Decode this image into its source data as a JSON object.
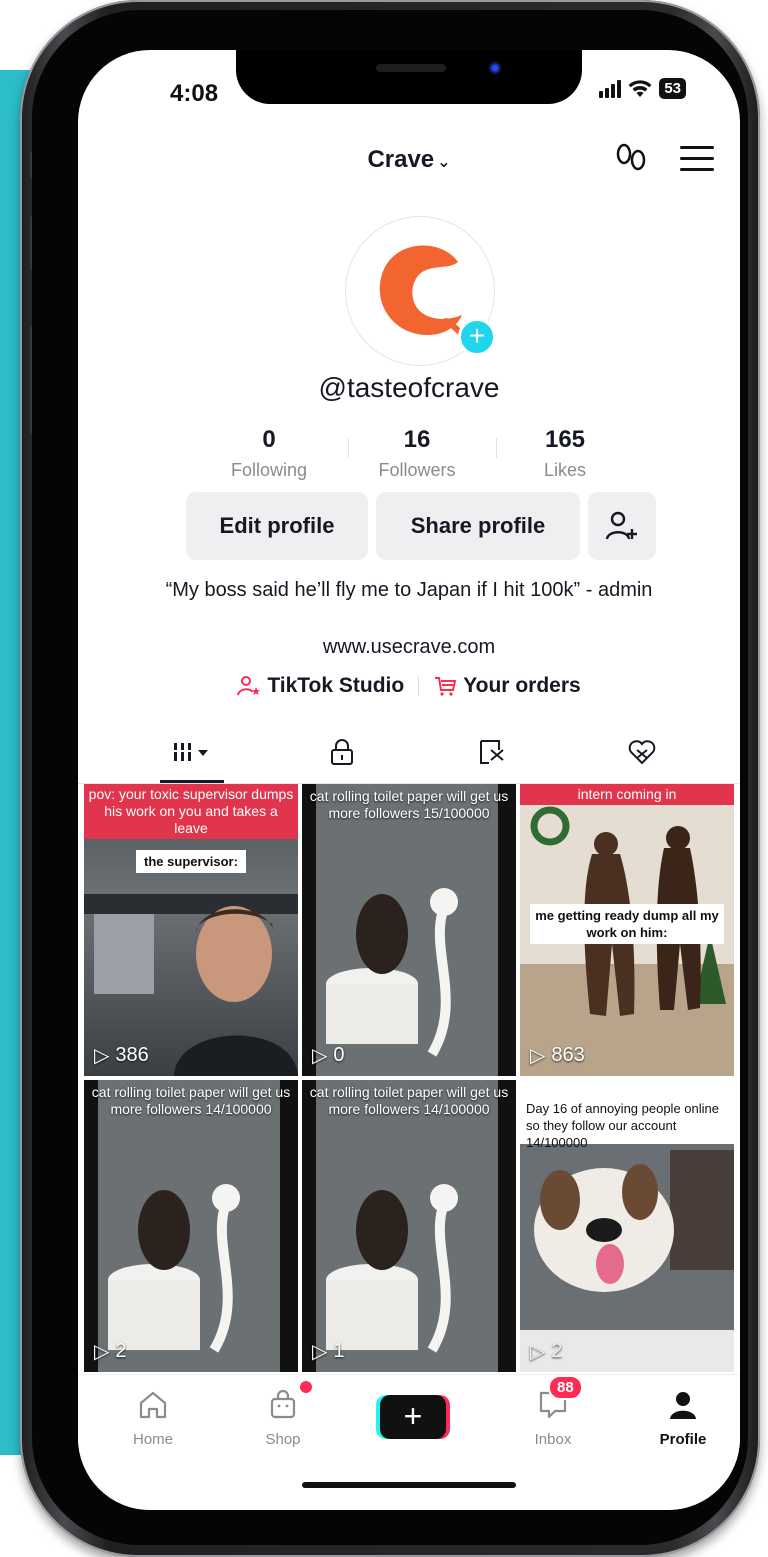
{
  "status_bar": {
    "time": "4:08",
    "battery": "53"
  },
  "header": {
    "title": "Crave"
  },
  "profile": {
    "username": "@tasteofcrave",
    "stats": [
      {
        "value": "0",
        "label": "Following"
      },
      {
        "value": "16",
        "label": "Followers"
      },
      {
        "value": "165",
        "label": "Likes"
      }
    ],
    "buttons": {
      "edit": "Edit profile",
      "share": "Share profile"
    },
    "bio": "“My boss said he’ll fly me to Japan if I hit 100k” - admin",
    "website": "www.usecrave.com",
    "links": [
      {
        "label": "TikTok Studio",
        "icon": "person-star-icon"
      },
      {
        "label": "Your orders",
        "icon": "cart-icon"
      }
    ]
  },
  "tabs": [
    {
      "icon": "grid-icon",
      "active": true
    },
    {
      "icon": "lock-icon",
      "active": false
    },
    {
      "icon": "repost-icon",
      "active": false
    },
    {
      "icon": "liked-heart-icon",
      "active": false
    }
  ],
  "videos": [
    {
      "caption_top": "pov: your toxic supervisor dumps his work on you and takes a leave",
      "caption_mid": "the supervisor:",
      "views": "386"
    },
    {
      "caption_top": "cat rolling toilet paper will get us more followers 15/100000",
      "views": "0"
    },
    {
      "caption_top": "intern coming in",
      "caption_mid": "me getting ready dump all my work on him:",
      "views": "863"
    },
    {
      "caption_top": "cat rolling toilet paper will get us more followers 14/100000",
      "views": "2"
    },
    {
      "caption_top": "cat rolling toilet paper will get us more followers 14/100000",
      "views": "1"
    },
    {
      "caption_top": "Day 16 of annoying people online so they follow our account 14/100000",
      "views": "2"
    }
  ],
  "bottom_nav": {
    "home": "Home",
    "shop": "Shop",
    "create": "+",
    "inbox": "Inbox",
    "inbox_badge": "88",
    "profile": "Profile"
  },
  "colors": {
    "backdrop": "#2bbdc8",
    "brand": "#f26531",
    "accent_red": "#fe2c55",
    "accent_cyan": "#20d5ec"
  }
}
